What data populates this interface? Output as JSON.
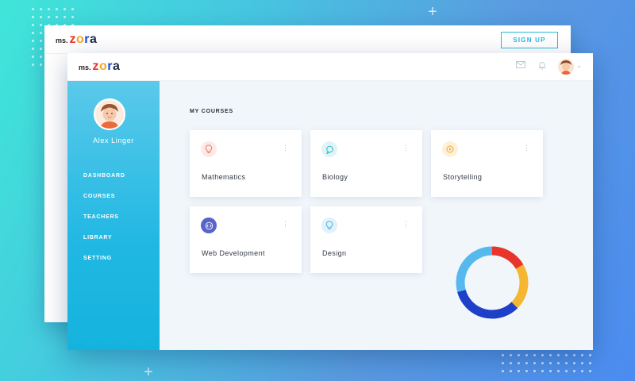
{
  "brand": {
    "ms": "ms.",
    "zora_letters": [
      "z",
      "o",
      "r",
      "a"
    ]
  },
  "back_window": {
    "signup_label": "SIGN UP"
  },
  "header": {
    "icons": [
      "mail-icon",
      "bell-icon",
      "chevron-down-icon"
    ]
  },
  "profile": {
    "name": "Alex Linger"
  },
  "nav": {
    "items": [
      {
        "label": "DASHBOARD"
      },
      {
        "label": "COURSES"
      },
      {
        "label": "TEACHERS"
      },
      {
        "label": "LIBRARY"
      },
      {
        "label": "SETTING"
      }
    ]
  },
  "main": {
    "section_title": "MY COURSES",
    "courses": [
      {
        "title": "Mathematics",
        "icon": "lightbulb-icon",
        "accent": "#f07a6a"
      },
      {
        "title": "Biology",
        "icon": "chat-icon",
        "accent": "#2fb5c9"
      },
      {
        "title": "Storytelling",
        "icon": "play-icon",
        "accent": "#f5a623"
      },
      {
        "title": "Web Development",
        "icon": "code-icon",
        "accent": "#5a63c8"
      },
      {
        "title": "Design",
        "icon": "lightbulb-icon",
        "accent": "#4ab3e6"
      }
    ]
  },
  "colors": {
    "donut": [
      "#e8342a",
      "#f5a623",
      "#1e4ad6",
      "#4ab3e6"
    ]
  }
}
